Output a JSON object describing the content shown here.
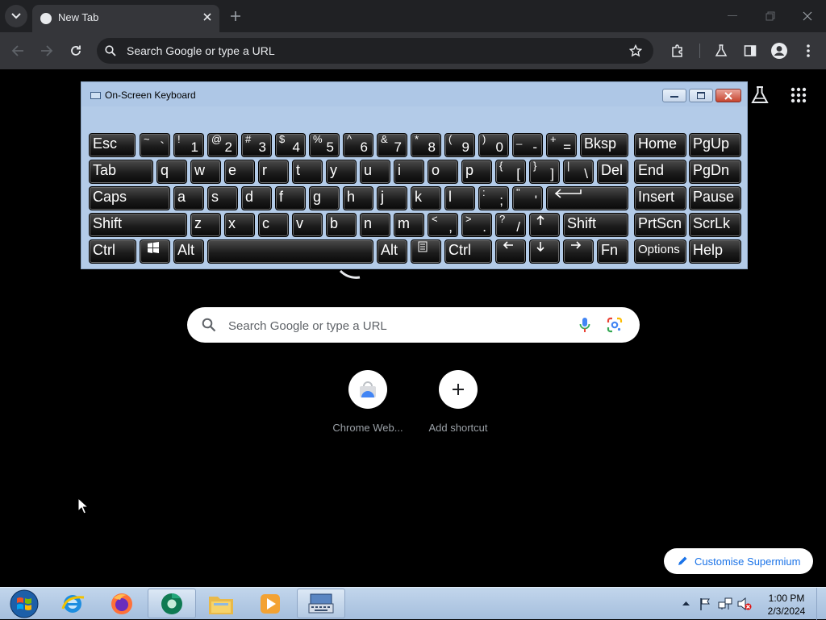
{
  "browser": {
    "tab_title": "New Tab",
    "omnibox_placeholder": "Search Google or type a URL"
  },
  "osk": {
    "title": "On-Screen Keyboard",
    "rows": [
      [
        [
          "Esc"
        ],
        [
          "`",
          "~"
        ],
        [
          "1",
          "!"
        ],
        [
          "2",
          "@"
        ],
        [
          "3",
          "#"
        ],
        [
          "4",
          "$"
        ],
        [
          "5",
          "%"
        ],
        [
          "6",
          "^"
        ],
        [
          "7",
          "&"
        ],
        [
          "8",
          "*"
        ],
        [
          "9",
          "("
        ],
        [
          "0",
          ")"
        ],
        [
          "-",
          "_"
        ],
        [
          "=",
          "+"
        ],
        [
          "Bksp"
        ],
        [
          "Home"
        ],
        [
          "PgUp"
        ]
      ],
      [
        [
          "Tab"
        ],
        [
          "q"
        ],
        [
          "w"
        ],
        [
          "e"
        ],
        [
          "r"
        ],
        [
          "t"
        ],
        [
          "y"
        ],
        [
          "u"
        ],
        [
          "i"
        ],
        [
          "o"
        ],
        [
          "p"
        ],
        [
          "[",
          "{"
        ],
        [
          "]",
          "}"
        ],
        [
          "\\",
          "|"
        ],
        [
          "Del"
        ],
        [
          "End"
        ],
        [
          "PgDn"
        ]
      ],
      [
        [
          "Caps"
        ],
        [
          "a"
        ],
        [
          "s"
        ],
        [
          "d"
        ],
        [
          "f"
        ],
        [
          "g"
        ],
        [
          "h"
        ],
        [
          "j"
        ],
        [
          "k"
        ],
        [
          "l"
        ],
        [
          ";",
          ":"
        ],
        [
          "'",
          "\""
        ],
        [
          "enter-icon"
        ],
        [
          "Insert"
        ],
        [
          "Pause"
        ]
      ],
      [
        [
          "Shift"
        ],
        [
          "z"
        ],
        [
          "x"
        ],
        [
          "c"
        ],
        [
          "v"
        ],
        [
          "b"
        ],
        [
          "n"
        ],
        [
          "m"
        ],
        [
          ",",
          "<"
        ],
        [
          ".",
          ">"
        ],
        [
          "/",
          "?"
        ],
        [
          "up-icon"
        ],
        [
          "Shift"
        ],
        [
          "PrtScn"
        ],
        [
          "ScrLk"
        ]
      ],
      [
        [
          "Ctrl"
        ],
        [
          "windows-icon"
        ],
        [
          "Alt"
        ],
        [
          " "
        ],
        [
          "Alt"
        ],
        [
          "menu-icon"
        ],
        [
          "Ctrl"
        ],
        [
          "left-icon"
        ],
        [
          "down-icon"
        ],
        [
          "right-icon"
        ],
        [
          "Fn"
        ],
        [
          "Options"
        ],
        [
          "Help"
        ]
      ]
    ]
  },
  "ntp": {
    "search_placeholder": "Search Google or type a URL",
    "shortcuts": [
      {
        "label": "Chrome Web...",
        "icon": "chrome-web-store-icon"
      },
      {
        "label": "Add shortcut",
        "icon": "plus-icon"
      }
    ],
    "customise_label": "Customise Supermium"
  },
  "taskbar": {
    "apps": [
      "start-orb-icon",
      "internet-explorer-icon",
      "firefox-icon",
      "supermium-browser-icon",
      "file-explorer-icon",
      "media-player-icon",
      "on-screen-keyboard-icon"
    ],
    "time": "1:00 PM",
    "date": "2/3/2024"
  }
}
